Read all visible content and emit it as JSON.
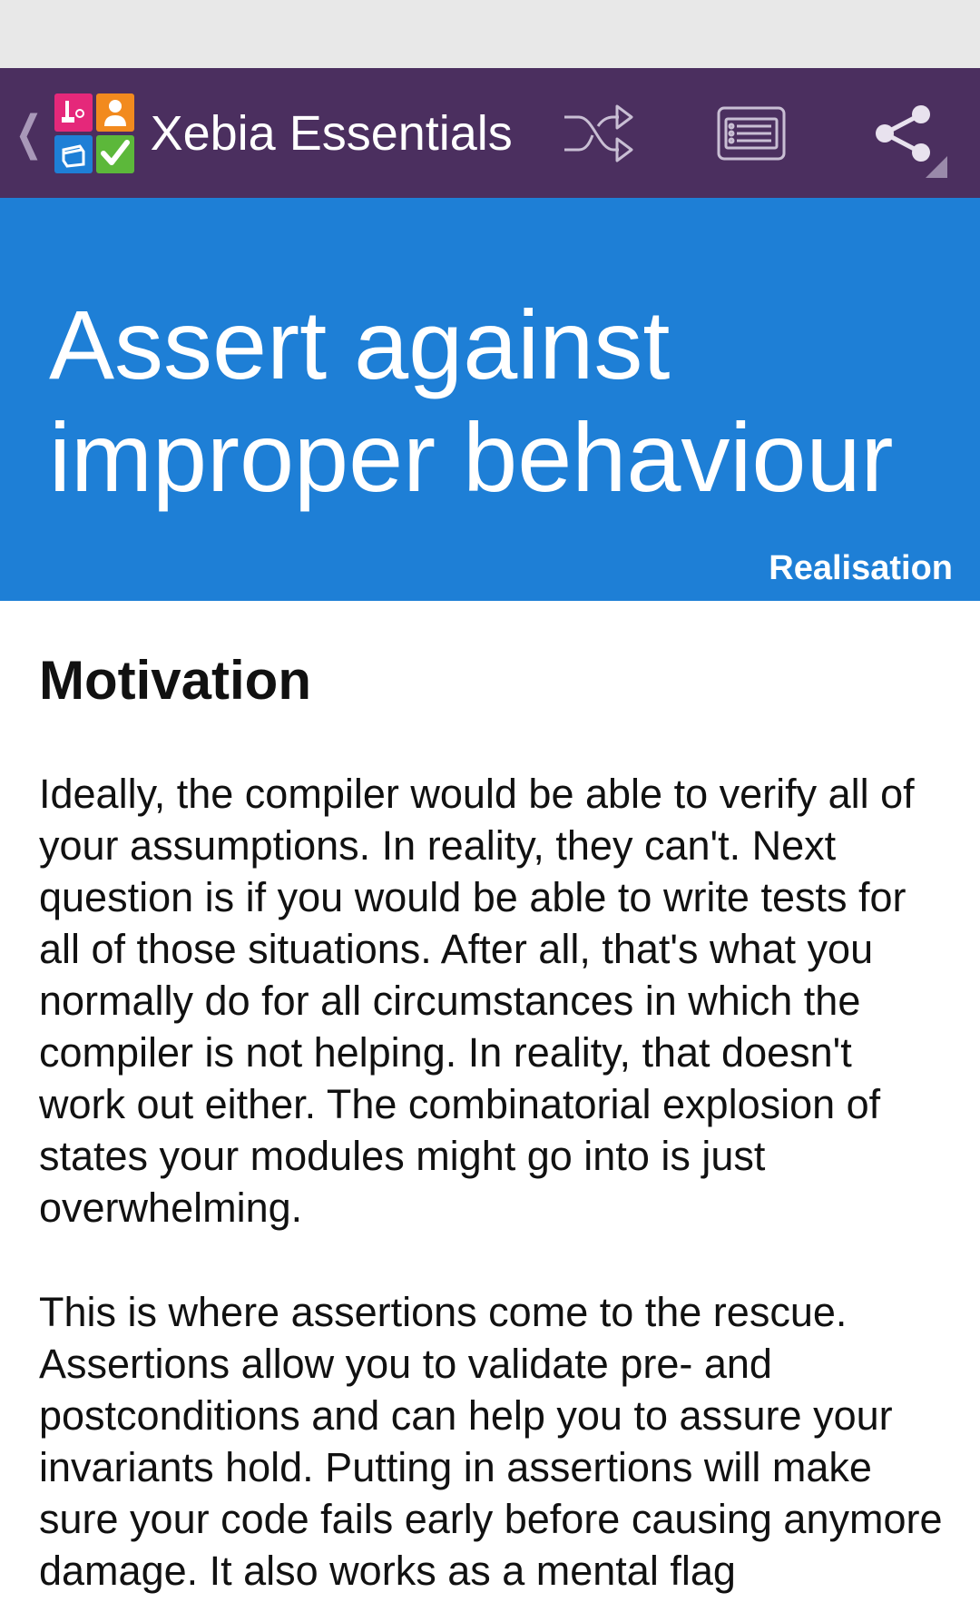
{
  "app": {
    "title": "Xebia Essentials"
  },
  "action_bar": {
    "back_icon": "chevron-left-icon",
    "actions": [
      {
        "name": "shuffle",
        "icon": "shuffle-icon"
      },
      {
        "name": "card-list",
        "icon": "card-list-icon"
      },
      {
        "name": "share",
        "icon": "share-icon"
      }
    ]
  },
  "card": {
    "title": "Assert against improper behaviour",
    "category": "Realisation",
    "color": "#1e7fd6"
  },
  "content": {
    "heading": "Motivation",
    "paragraphs": [
      "Ideally, the compiler would be able to verify all of your assumptions. In reality, they can't. Next question is if you would be able to write tests for all of those situations. After all, that's what you normally do for all circumstances in which the compiler is not helping. In reality, that doesn't work out either. The combinatorial explosion of states your modules might go into is just overwhelming.",
      "This is where assertions come to the rescue. Assertions allow you to validate pre- and postconditions and can help you to assure your invariants hold. Putting in assertions will make sure your code fails early before causing anymore damage. It also works as a mental flag"
    ]
  },
  "colors": {
    "action_bar": "#4b2f5f",
    "status_bar": "#e8e8e8",
    "text": "#111111"
  }
}
